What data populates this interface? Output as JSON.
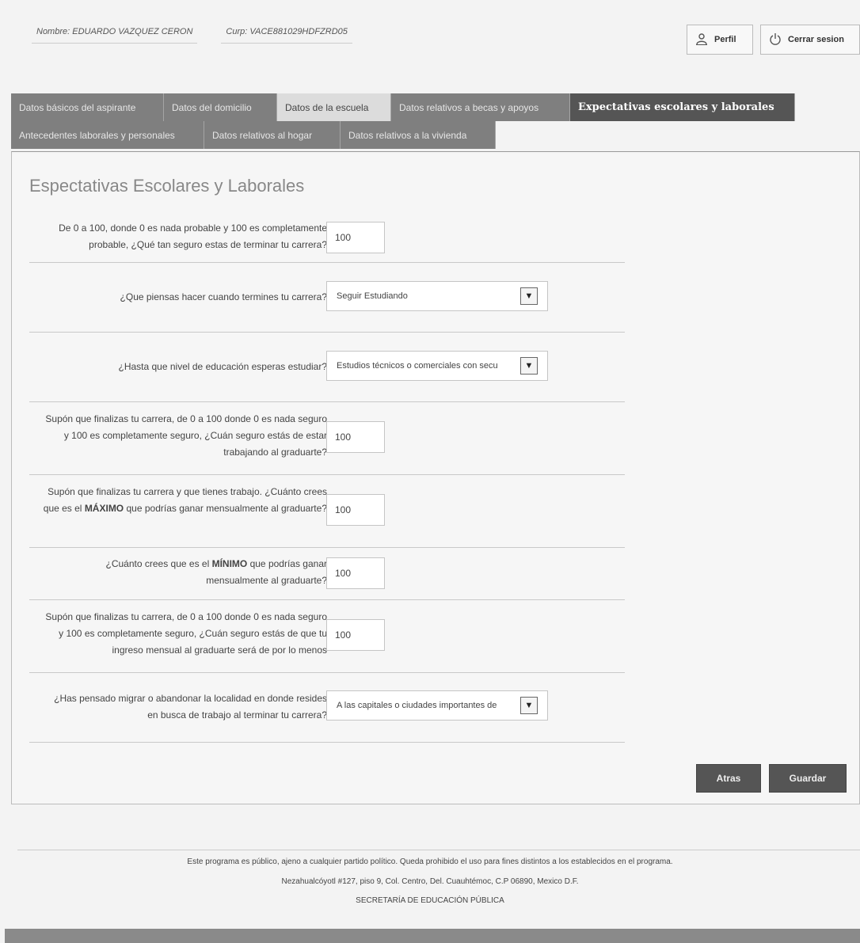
{
  "header": {
    "nombre": "Nombre: EDUARDO VAZQUEZ CERON",
    "curp": "Curp: VACE881029HDFZRD05",
    "perfil_label": "Perfil",
    "logout_label": "Cerrar sesion"
  },
  "tabs": {
    "row1": [
      {
        "label": "Datos básicos del aspirante"
      },
      {
        "label": "Datos del domicilio"
      },
      {
        "label": "Datos de la escuela"
      },
      {
        "label": "Datos relativos a becas y apoyos"
      },
      {
        "label": "Expectativas escolares y laborales"
      }
    ],
    "row2": [
      {
        "label": "Antecedentes laborales y personales"
      },
      {
        "label": "Datos relativos al hogar"
      },
      {
        "label": "Datos relativos a la vivienda"
      }
    ]
  },
  "form": {
    "title": "Espectativas Escolares y Laborales",
    "q1": {
      "label": "De 0 a 100, donde 0 es nada probable y 100 es completamente probable, ¿Qué tan seguro estas de terminar tu carrera?",
      "value": "100"
    },
    "q2": {
      "label": "¿Que piensas hacer cuando termines tu carrera?",
      "value": "Seguir Estudiando"
    },
    "q3": {
      "label": "¿Hasta que nivel de educación esperas estudiar?",
      "value": "Estudios técnicos o comerciales con secu"
    },
    "q4": {
      "label": "Supón que finalizas tu carrera, de 0 a 100 donde 0 es nada seguro y 100 es completamente seguro, ¿Cuán seguro estás de estar trabajando al graduarte?",
      "value": "100"
    },
    "q5": {
      "label_pre": "Supón que finalizas tu carrera y que tienes trabajo. ¿Cuánto crees que es el ",
      "label_bold": "MÁXIMO",
      "label_post": " que podrías ganar mensualmente al graduarte?",
      "value": "100"
    },
    "q6": {
      "label_pre": "¿Cuánto crees que es el ",
      "label_bold": "MÍNIMO",
      "label_post": " que podrías ganar mensualmente al graduarte?",
      "value": "100"
    },
    "q7": {
      "label": "Supón que finalizas tu carrera, de 0 a 100 donde 0 es nada seguro y 100 es completamente seguro, ¿Cuán seguro estás de que tu ingreso mensual al graduarte será de por lo menos",
      "value": "100"
    },
    "q8": {
      "label": "¿Has pensado migrar o abandonar la localidad en donde resides en busca de trabajo al terminar tu carrera?",
      "value": "A las capitales o ciudades importantes de"
    },
    "back_label": "Atras",
    "save_label": "Guardar"
  },
  "footer": {
    "line1": "Este programa es público, ajeno a cualquier partido político. Queda prohibido el uso para fines distintos a los establecidos en el programa.",
    "line2": "Nezahualcóyotl #127, piso 9, Col. Centro, Del. Cuauhtémoc, C.P 06890, Mexico D.F.",
    "line3": "SECRETARÍA DE EDUCACIÓN PÚBLICA"
  },
  "icons": {
    "perfil": "user-profile-icon",
    "logout": "power-icon",
    "dropdown": "chevron-down-icon"
  },
  "colors": {
    "tab_inactive": "#7f7f7f",
    "tab_active": "#555555",
    "button": "#555555"
  }
}
